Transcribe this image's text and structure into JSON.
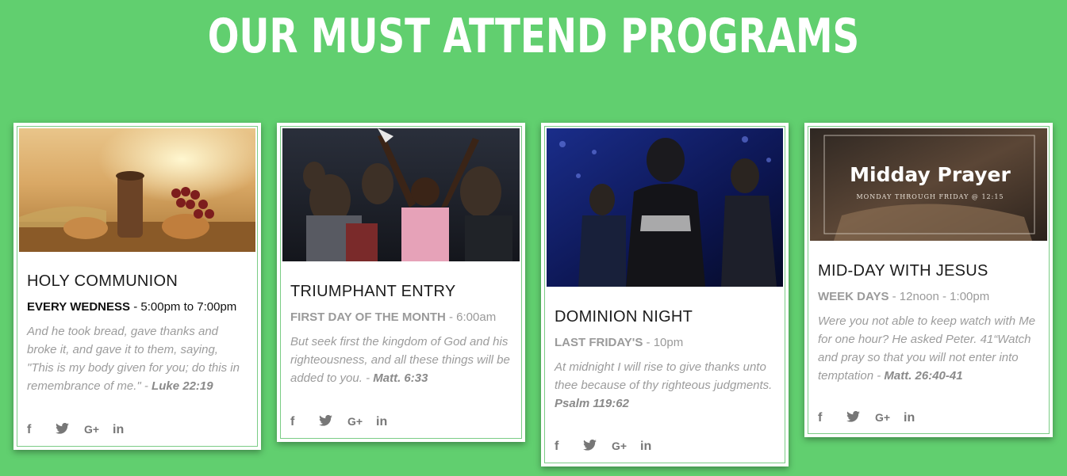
{
  "heading": "OUR MUST ATTEND PROGRAMS",
  "colors": {
    "background": "#61cf6f",
    "accent_outline": "#7acc85"
  },
  "social_icons": [
    "facebook-icon",
    "twitter-icon",
    "google-plus-icon",
    "linkedin-icon"
  ],
  "social_glyphs": {
    "facebook": "f",
    "twitter": "🐦",
    "google": "G+",
    "linkedin": "in"
  },
  "cards": [
    {
      "title": "HOLY COMMUNION",
      "day": "EVERY WEDNESS",
      "time": " - 5:00pm to 7:00pm",
      "quote": "And he took bread, gave thanks and broke it, and gave it to them, saying, \"This is my body given for you; do this in remembrance of me.\" - ",
      "ref": "Luke 22:19",
      "image": "bread, cup and grapes at sunset"
    },
    {
      "title": "TRIUMPHANT ENTRY",
      "day": "FIRST DAY OF THE MONTH",
      "time": " - 6:00am",
      "quote": "But seek first the kingdom of God and his righteousness, and all these things will be added to you. - ",
      "ref": "Matt. 6:33",
      "image": "worshippers raising hands"
    },
    {
      "title": "DOMINION NIGHT",
      "day": "LAST FRIDAY'S",
      "time": " - 10pm",
      "quote": "At midnight I will rise to give thanks unto thee because of thy righteous judgments. ",
      "ref": "Psalm 119:62",
      "image": "people praying in blue stage light"
    },
    {
      "title": "MID-DAY WITH JESUS",
      "day": "WEEK DAYS",
      "time": " - 12noon - 1:00pm",
      "quote": "Were you not able to keep watch with Me for one hour? He asked Peter. 41“Watch and pray so that you will not enter into temptation - ",
      "ref": "Matt. 26:40-41",
      "image_title": "Midday Prayer",
      "image_subtitle": "MONDAY THROUGH FRIDAY @ 12:15"
    }
  ]
}
